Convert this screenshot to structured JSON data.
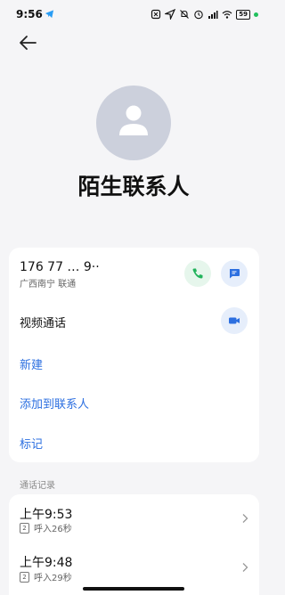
{
  "status_bar": {
    "time": "9:56",
    "battery": "59"
  },
  "contact": {
    "name": "陌生联系人"
  },
  "number_card": {
    "phone": "176 77 … 9··",
    "location": "广西南宁 联通",
    "video_label": "视频通话",
    "actions": [
      "新建",
      "添加到联系人",
      "标记"
    ]
  },
  "call_log": {
    "section_label": "通话记录",
    "entries": [
      {
        "time": "上午9:53",
        "sim": "2",
        "detail": "呼入26秒"
      },
      {
        "time": "上午9:48",
        "sim": "2",
        "detail": "呼入29秒"
      }
    ]
  },
  "colors": {
    "accent": "#2c6fe0",
    "call_green": "#21b35b",
    "avatar_bg": "#ccd0dc"
  }
}
